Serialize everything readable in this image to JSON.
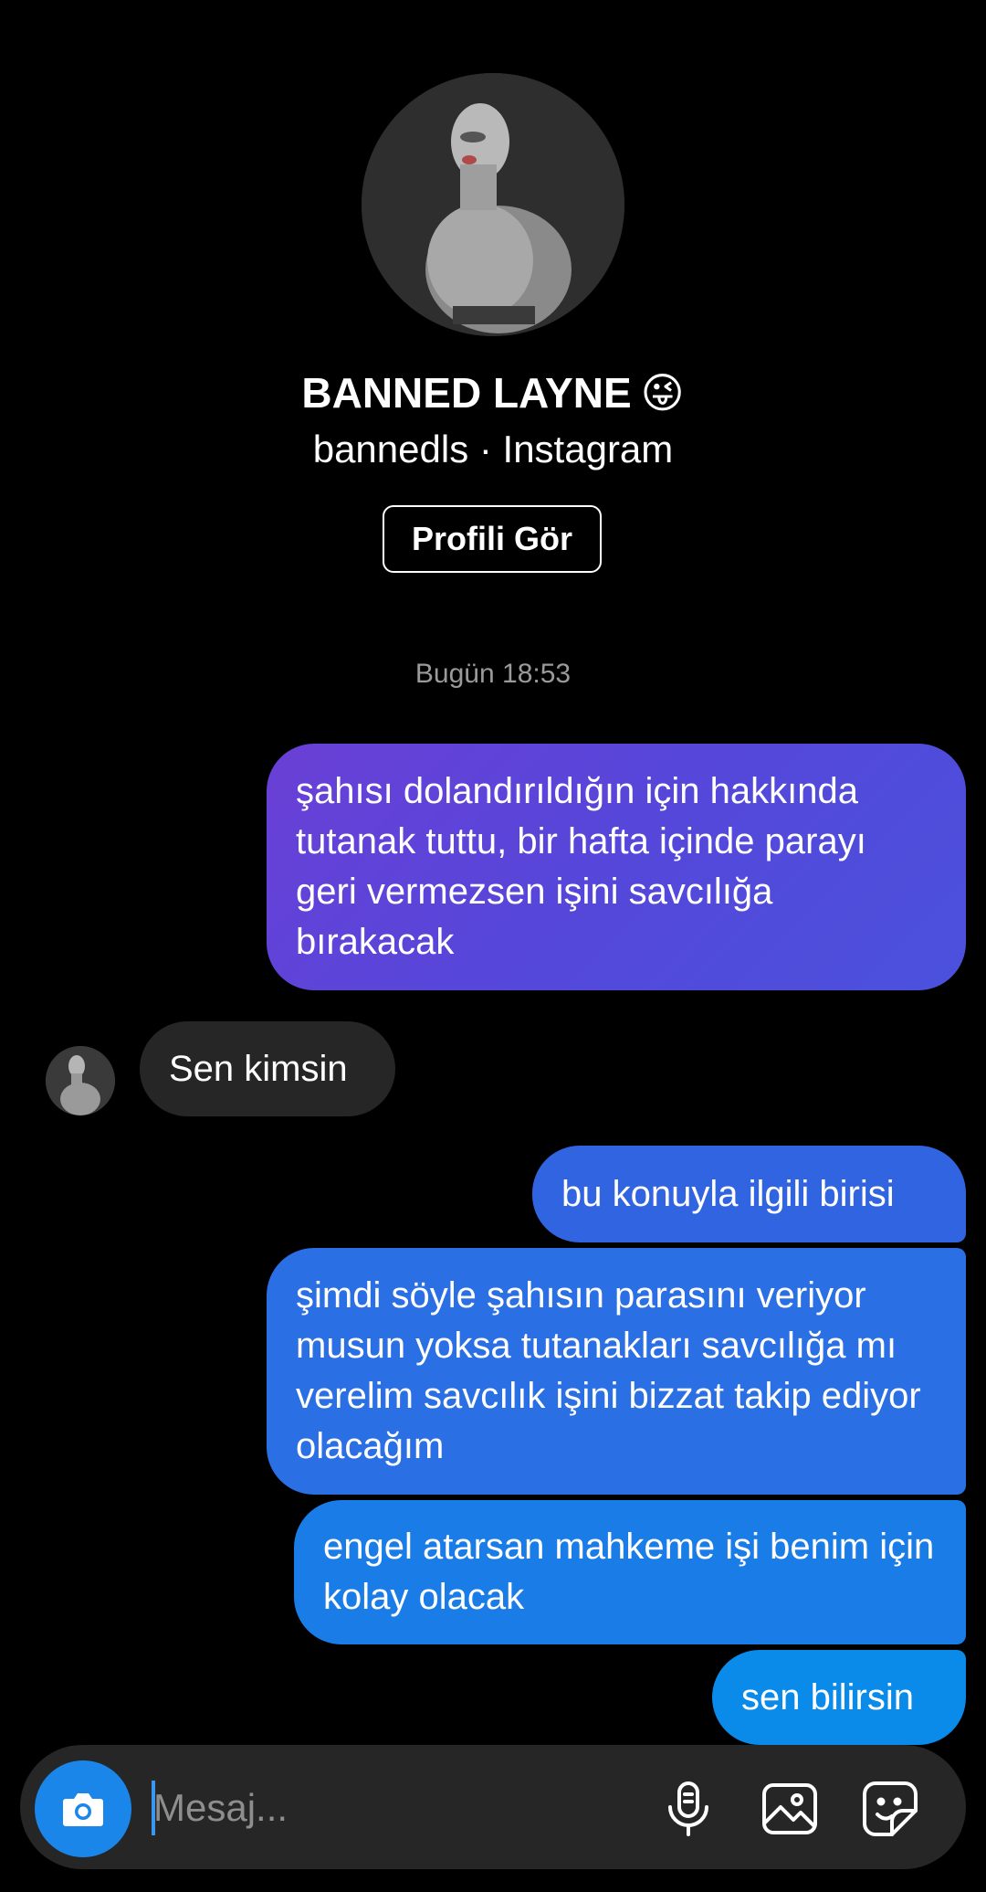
{
  "header": {
    "display_name": "BANNED LAYNE",
    "name_emoji": "😜",
    "subtitle": "bannedls · Instagram",
    "view_profile_label": "Profili Gör"
  },
  "conversation": {
    "timestamp": "Bugün 18:53",
    "messages": [
      {
        "sender": "me",
        "text": "şahısı dolandırıldığın için hakkında tutanak tuttu, bir hafta içinde parayı geri vermezsen işini savcılığa bırakacak"
      },
      {
        "sender": "them",
        "text": "Sen kimsin"
      },
      {
        "sender": "me",
        "text": "bu konuyla ilgili birisi"
      },
      {
        "sender": "me",
        "text": "şimdi söyle şahısın parasını veriyor musun yoksa tutanakları savcılığa mı verelim savcılık işini bizzat takip ediyor olacağım"
      },
      {
        "sender": "me",
        "text": "engel atarsan mahkeme işi benim için kolay olacak"
      },
      {
        "sender": "me",
        "text": "sen bilirsin"
      }
    ]
  },
  "composer": {
    "placeholder": "Mesaj...",
    "icons": {
      "camera": "camera-icon",
      "mic": "microphone-icon",
      "gallery": "gallery-icon",
      "sticker": "sticker-icon"
    }
  },
  "colors": {
    "background": "#000000",
    "incoming_bubble": "#262626",
    "outgoing_gradient_top": "#6a3fd6",
    "outgoing_gradient_bottom": "#0a8ae9",
    "camera_button": "#1a86ea",
    "timestamp": "#9a9a9a"
  }
}
